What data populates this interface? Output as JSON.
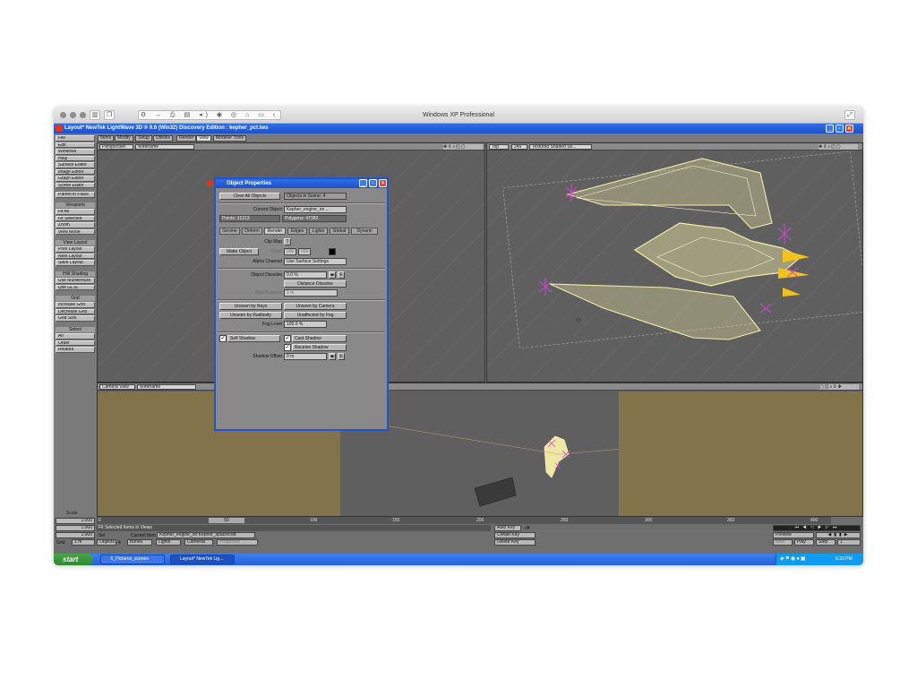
{
  "mac": {
    "title": "Windows XP Professional",
    "toolbar_icons": [
      "back-icon",
      "forward-icon",
      "print-icon",
      "share-icon",
      "volume-icon",
      "camera-icon",
      "settings-icon",
      "lock-icon",
      "folder-icon",
      "chevron-left-icon"
    ]
  },
  "app": {
    "title": "Layout* NewTek LightWave 3D ® 9.6 (Win32) Discovery Edition : kepher_pct.lws",
    "main_tabs": [
      "Items",
      "Modify",
      "Setup",
      "Utilities",
      "Render",
      "View",
      "Modeler Tools"
    ],
    "active_tab": "View"
  },
  "left_menu": {
    "top": [
      "File",
      "Edit",
      "Windows",
      "Help",
      "Surface Editor",
      "Image Editor",
      "Graph Editor",
      "Scene Editor"
    ],
    "parent": "Parent in Place",
    "viewports_header": "Viewports",
    "viewports": [
      "Fit All",
      "Fit Selected",
      "Zoom",
      "View Mode"
    ],
    "view_layout_header": "View Layout",
    "view_layout": [
      "Prev Layout",
      "Next Layout",
      "Save Layout"
    ],
    "shading_header": "HW Shading",
    "shading": [
      "Use Multitexture",
      "Use GLSL"
    ],
    "grid_header": "Grid",
    "grid": [
      "Increase Grid",
      "Decrease Grid",
      "Grid Size"
    ],
    "select_header": "Select",
    "select": [
      "All",
      "Order",
      "Related"
    ]
  },
  "viewports": {
    "top_left": {
      "view": "Perspective",
      "mode": "Wireframe"
    },
    "top_right": {
      "view": "Top",
      "zoom": "245",
      "mode": "Textured Shaded So..."
    },
    "bottom": {
      "view": "Camera View",
      "mode": "Wireframe"
    }
  },
  "dialog": {
    "title": "Object Properties",
    "clear_all": "Clear All Objects",
    "objects_in_scene": "Objects in Scene: 4",
    "current_object_label": "Current Object",
    "current_object": "Kepher_engine_on ...",
    "points": "Points: 31213",
    "polygons": "Polygons: 47382",
    "tabs": [
      "Geome",
      "Deform",
      "Render",
      "Edges",
      "Lights",
      "Global",
      "Dynami"
    ],
    "active_tab": "Render",
    "clip_map_label": "Clip Map",
    "clip_map_btn": "T",
    "matte_object": "Matte Object",
    "color_label": "Color",
    "color_values": [
      "000",
      "000"
    ],
    "alpha_label": "Alpha Channel",
    "alpha_value": "Use Surface Settings",
    "dissolve_label": "Object Dissolve",
    "dissolve_value": "0.0 %",
    "distance_dissolve": "Distance Dissolve",
    "max_distance_label": "Max Distance",
    "max_distance_value": "1 m",
    "unseen_rays": "Unseen by Rays",
    "unseen_camera": "Unseen by Camera",
    "unseen_radiosity": "Unseen by Radiosity",
    "unaffected_fog": "Unaffected by Fog",
    "fog_level_label": "Fog Level",
    "fog_level_value": "100.0 %",
    "self_shadow": "Self Shadow",
    "cast_shadow": "Cast Shadow",
    "receive_shadow": "Receive Shadow",
    "shadow_offset_label": "Shadow Offset",
    "shadow_offset_value": "0 m",
    "env_btn": "E"
  },
  "bottom": {
    "scale_label": "Scale",
    "timeline_ticks": [
      "0",
      "50",
      "100",
      "150",
      "200",
      "250",
      "300",
      "350",
      "400"
    ],
    "current_frame": "50",
    "end_frame": "400",
    "fields": [
      "1.000",
      "1.000",
      "1.000"
    ],
    "sel_label": "Sel",
    "grid_label": "Grid",
    "grid_value": "1 m",
    "status": "Fit Selected Items in Views",
    "current_item_label": "Current Item",
    "current_item": "Kepher_engine_on:Kepher_spacecraft",
    "item_buttons": [
      "Objects",
      "Bones",
      "Lights",
      "Cameras",
      "Properties"
    ],
    "objects_count": "4",
    "auto_key": "Auto Key",
    "auto_key_value": "off",
    "create_key": "Create Key",
    "delete_key": "Delete Key",
    "preview": "Preview",
    "rewind_label": "Rwd",
    "play_label": "Play",
    "step_label": "Step",
    "step_value": "1"
  },
  "taskbar": {
    "start": "start",
    "tasks": [
      "X_Pictures_scenes",
      "Layout* NewTek Lig..."
    ],
    "clock": "6:33 PM"
  },
  "colors": {
    "xp_blue": "#2458d6",
    "viewport_gray": "#5f5f5f",
    "wire_yellow": "#f3eca8",
    "magenta": "#d246d6",
    "camera_floor": "#83734a"
  }
}
